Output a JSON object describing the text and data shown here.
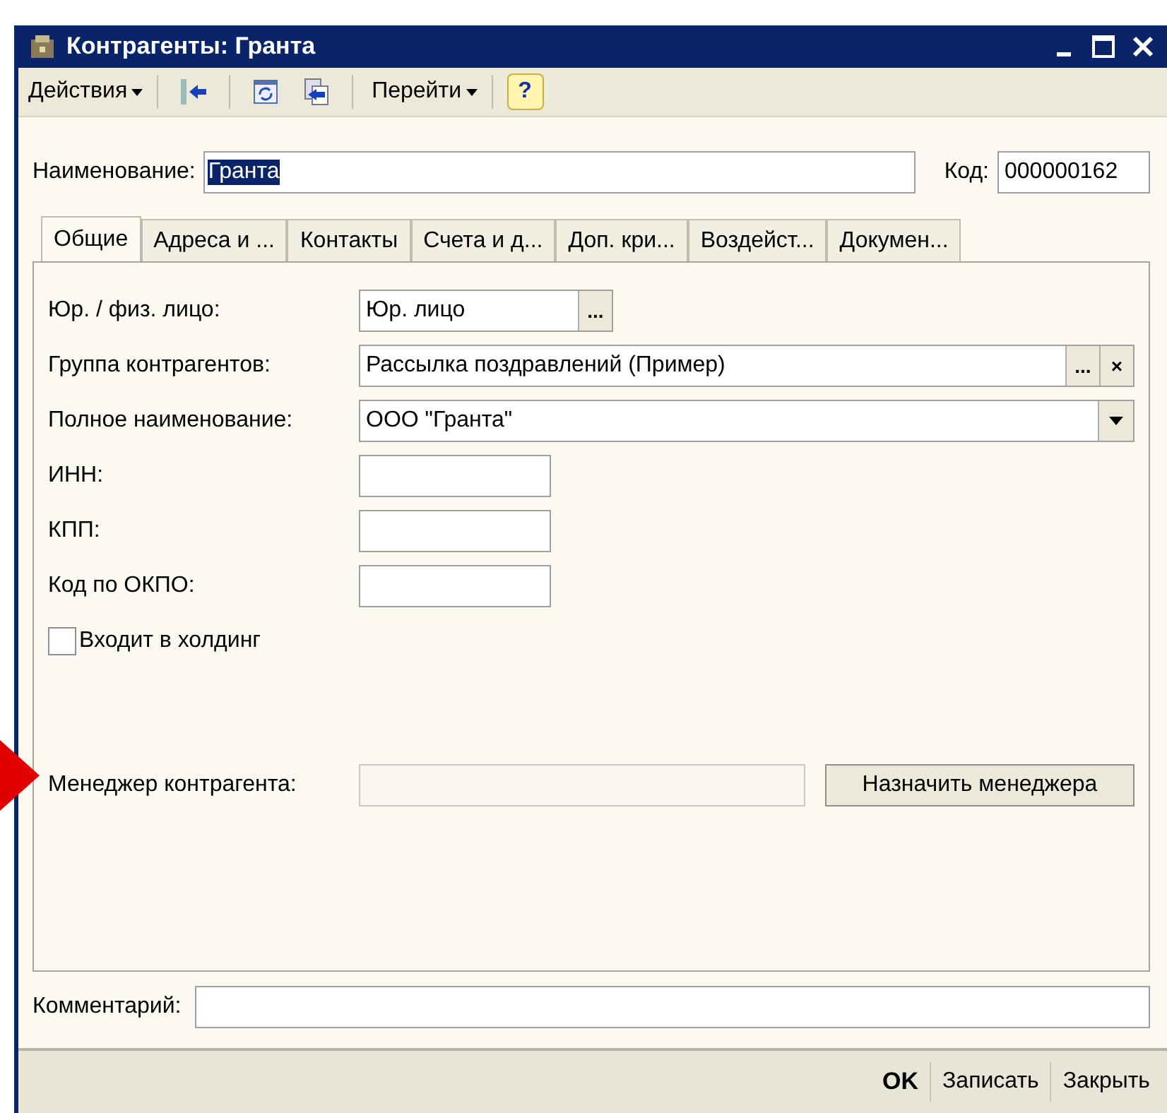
{
  "window": {
    "title": "Контрагенты: Гранта"
  },
  "toolbar": {
    "actions_menu": "Действия",
    "goto_menu": "Перейти",
    "help": "?"
  },
  "header": {
    "name_label": "Наименование:",
    "name_value": "Гранта",
    "name_value_selected": true,
    "code_label": "Код:",
    "code_value": "000000162"
  },
  "tabs": [
    {
      "label": "Общие",
      "selected": true
    },
    {
      "label": "Адреса и ...",
      "selected": false
    },
    {
      "label": "Контакты",
      "selected": false
    },
    {
      "label": "Счета и д...",
      "selected": false
    },
    {
      "label": "Доп. кри...",
      "selected": false
    },
    {
      "label": "Воздейст...",
      "selected": false
    },
    {
      "label": "Докумен...",
      "selected": false
    }
  ],
  "fields": [
    {
      "kind": "reference",
      "label": "Юр. / физ. лицо:",
      "value": "Юр. лицо",
      "buttons": [
        "..."
      ]
    },
    {
      "kind": "wide-reference",
      "label": "Группа контрагентов:",
      "value": "Рассылка поздравлений (Пример)",
      "buttons": [
        "...",
        "×"
      ]
    },
    {
      "kind": "combo",
      "label": "Полное наименование:",
      "value": "ООО \"Гранта\""
    },
    {
      "kind": "text",
      "label": "ИНН:"
    },
    {
      "kind": "text",
      "label": "КПП:"
    },
    {
      "kind": "text",
      "label": "Код по ОКПО:"
    },
    {
      "kind": "checkbox",
      "label": "Входит в холдинг",
      "checked": false
    }
  ],
  "manager": {
    "label": "Менеджер контрагента:",
    "disabled": true,
    "button": "Назначить менеджера"
  },
  "comment": {
    "label": "Комментарий:"
  },
  "footer_buttons": [
    {
      "label": "OK",
      "default": true
    },
    {
      "label": "Записать",
      "default": false
    },
    {
      "label": "Закрыть",
      "default": false
    }
  ]
}
